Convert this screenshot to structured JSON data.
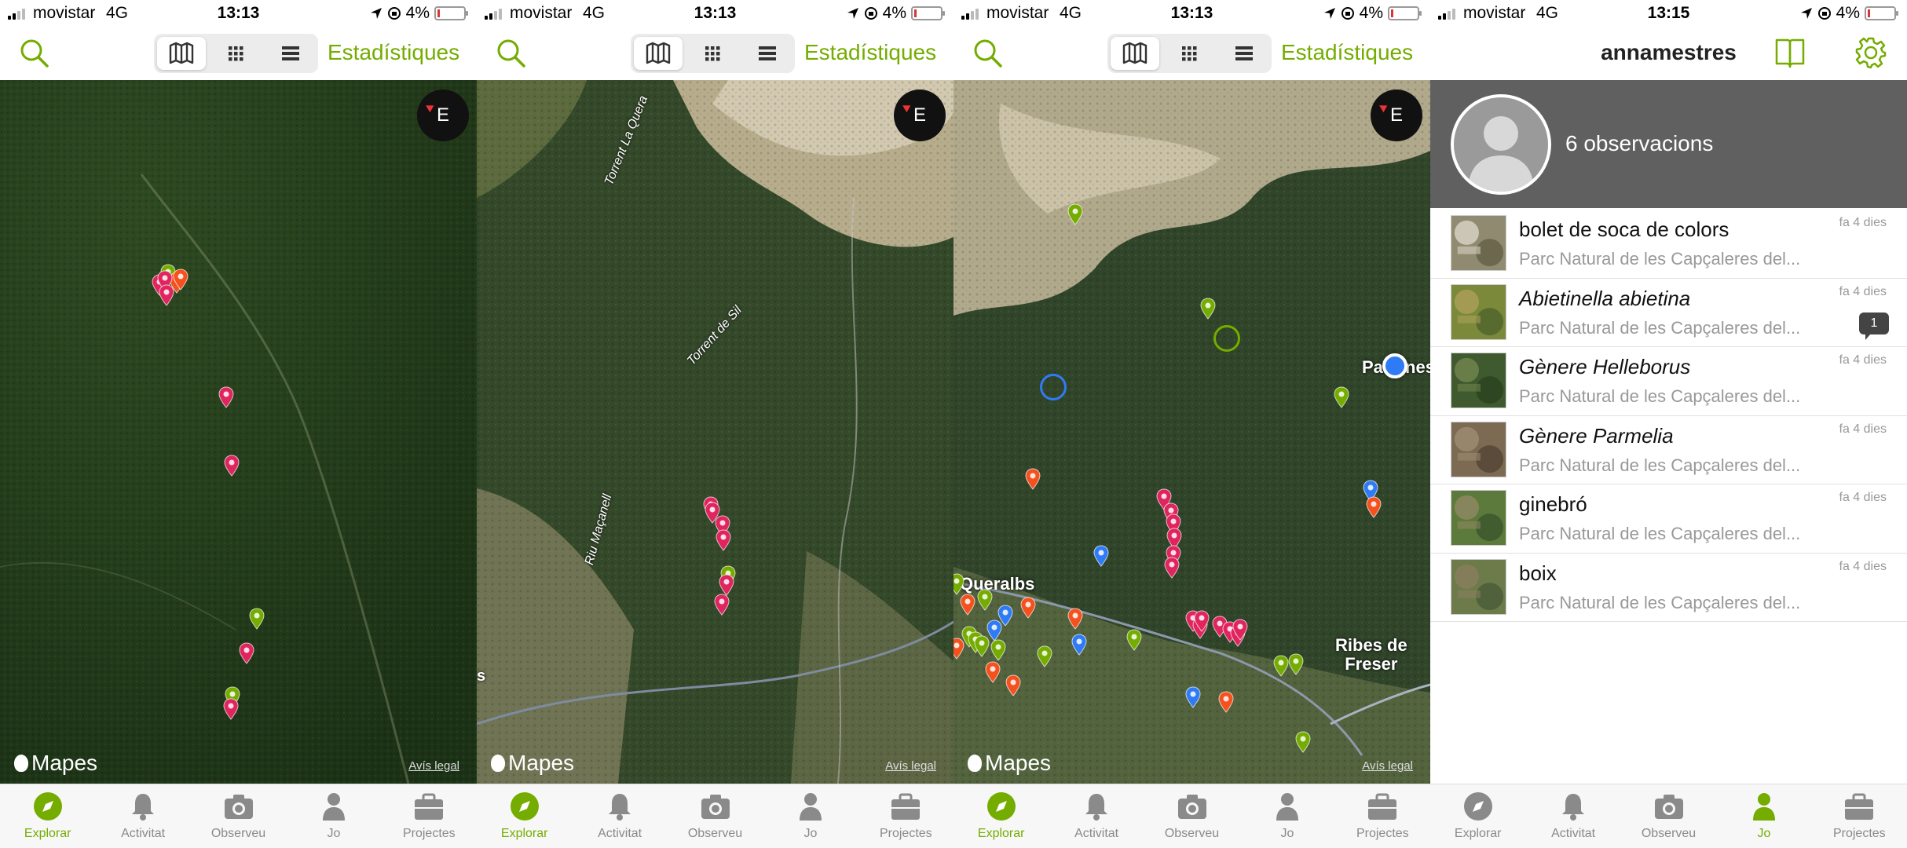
{
  "status": {
    "carrier": "movistar",
    "network": "4G",
    "battery": "4%",
    "times": [
      "13:13",
      "13:13",
      "13:13",
      "13:15"
    ]
  },
  "explore": {
    "stats_label": "Estadístiques",
    "view_modes": [
      "map-icon",
      "grid-icon",
      "list-icon"
    ],
    "active_view": "map"
  },
  "map": {
    "compass_label": "E",
    "attribution": "Mapes",
    "legal": "Avís legal",
    "labels_s2": [
      "Torrent La Quera",
      "Torrent de Sil",
      "Riu Maçanell"
    ],
    "labels_s3": [
      "Queralbs",
      "Ribes de\nFreser",
      "Pardines"
    ],
    "edge_letter": "s"
  },
  "tabs": [
    "Explorar",
    "Activitat",
    "Observeu",
    "Jo",
    "Projectes"
  ],
  "profile": {
    "username": "annamestres",
    "observations_count": "6 observacions",
    "items": [
      {
        "name": "bolet de soca de colors",
        "italic": false,
        "place": "Parc Natural de les Capçaleres del...",
        "time": "fa 4 dies",
        "badge": ""
      },
      {
        "name": "Abietinella abietina",
        "italic": true,
        "place": "Parc Natural de les Capçaleres del...",
        "time": "fa 4 dies",
        "badge": "1"
      },
      {
        "name": "Gènere Helleborus",
        "italic": true,
        "place": "Parc Natural de les Capçaleres del...",
        "time": "fa 4 dies",
        "badge": ""
      },
      {
        "name": "Gènere Parmelia",
        "italic": true,
        "place": "Parc Natural de les Capçaleres del...",
        "time": "fa 4 dies",
        "badge": ""
      },
      {
        "name": "ginebró",
        "italic": false,
        "place": "Parc Natural de les Capçaleres del...",
        "time": "fa 4 dies",
        "badge": ""
      },
      {
        "name": "boix",
        "italic": false,
        "place": "Parc Natural de les Capçaleres del...",
        "time": "fa 4 dies",
        "badge": ""
      }
    ]
  },
  "colors": {
    "accent": "#74ac00",
    "pin_pink": "#e0245e",
    "pin_green": "#74ac00",
    "pin_orange": "#f4511e",
    "pin_blue": "#2f7bf5",
    "banner": "#606060"
  }
}
